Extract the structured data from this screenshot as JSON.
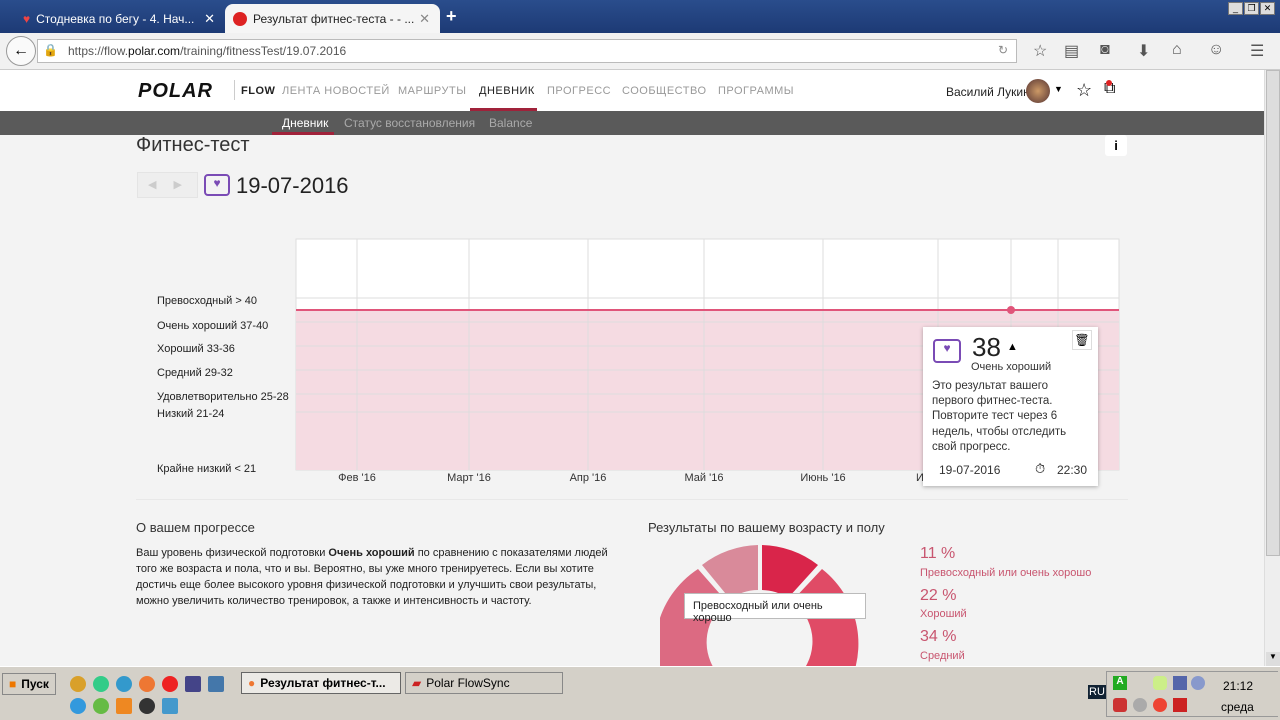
{
  "browser": {
    "tabs": [
      {
        "title": "Стодневка по бегу - 4. Нач...",
        "active": false
      },
      {
        "title": "Результат фитнес-теста - - ...",
        "active": true
      }
    ],
    "new_tab": "+",
    "url_prefix": "https://flow.",
    "url_domain": "polar.com",
    "url_path": "/training/fitnessTest/19.07.2016"
  },
  "header": {
    "logo": "POLAR",
    "flow": "FLOW",
    "menu": [
      "ЛЕНТА НОВОСТЕЙ",
      "МАРШРУТЫ",
      "ДНЕВНИК",
      "ПРОГРЕСС",
      "СООБЩЕСТВО",
      "ПРОГРАММЫ"
    ],
    "active_menu": "ДНЕВНИК",
    "user": "Василий Лукин"
  },
  "subnav": [
    "Дневник",
    "Статус восстановления",
    "Balance"
  ],
  "page": {
    "title": "Фитнес-тест",
    "date": "19-07-2016",
    "info": "i"
  },
  "chart": {
    "y_labels": [
      "Превосходный > 40",
      "Очень хороший 37-40",
      "Хороший 33-36",
      "Средний 29-32",
      "Удовлетворительно 25-28",
      "Низкий 21-24",
      "Крайне низкий < 21"
    ],
    "x_labels": [
      "Фев '16",
      "Март '16",
      "Апр '16",
      "Май '16",
      "Июнь '16",
      "И"
    ],
    "value": 38
  },
  "popup": {
    "value": "38",
    "level": "Очень хороший",
    "text": "Это результат вашего первого фитнес-теста. Повторите тест через 6 недель, чтобы отследить свой прогресс.",
    "date": "19-07-2016",
    "time": "22:30"
  },
  "progress": {
    "title": "О вашем прогрессе",
    "text_before": "Ваш уровень физической подготовки ",
    "text_bold": "Очень хороший",
    "text_after": " по сравнению с показателями людей того же возраста и пола, что и вы. Вероятно, вы уже много тренируетесь. Если вы хотите достичь еще более высокого уровня физической подготовки и улучшить свои результаты, можно увеличить количество тренировок, а также и интенсивность и частоту."
  },
  "results": {
    "title": "Результаты по вашему возрасту и полу",
    "tooltip": "Превосходный или очень хорошо",
    "legend": [
      {
        "value": "11 %",
        "label": "Превосходный или очень хорошо"
      },
      {
        "value": "22 %",
        "label": "Хороший"
      },
      {
        "value": "34 %",
        "label": "Средний"
      }
    ]
  },
  "taskbar": {
    "start": "Пуск",
    "windows": [
      "Результат фитнес-т...",
      "Polar FlowSync"
    ],
    "lang": "RU",
    "time": "21:12",
    "day": "среда"
  }
}
